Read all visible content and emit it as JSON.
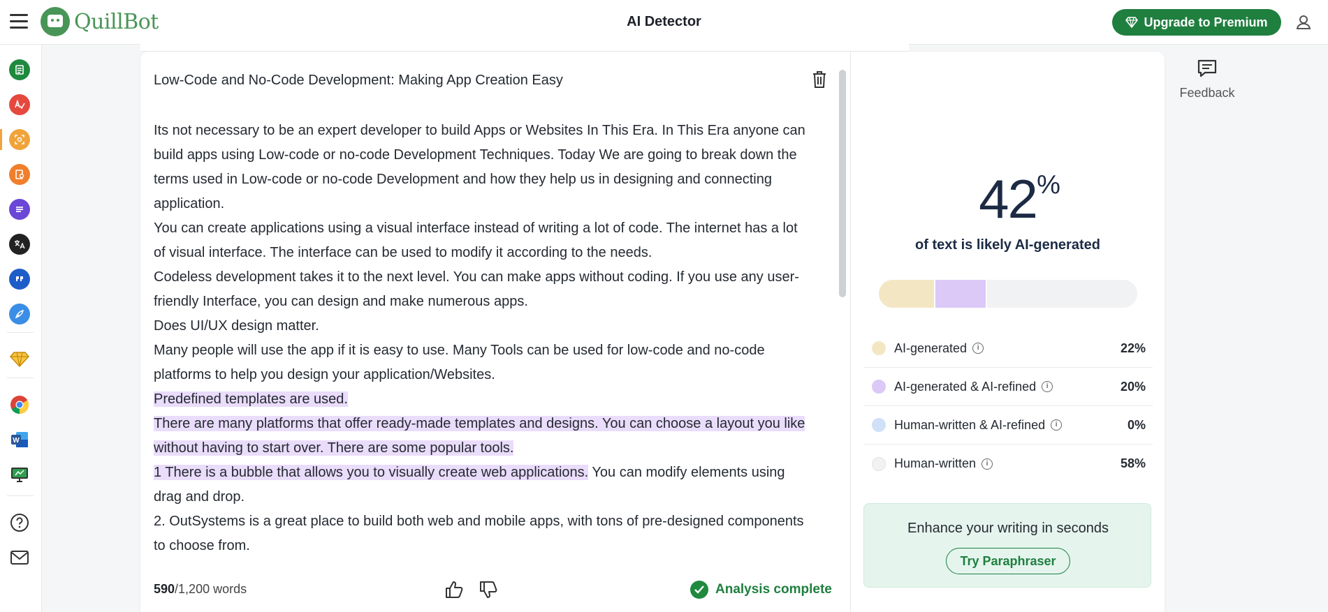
{
  "app": {
    "logo_text": "QuillBot",
    "page_title": "AI Detector",
    "upgrade_label": "Upgrade to Premium"
  },
  "sidebar": {
    "items": [
      {
        "name": "paraphraser",
        "color": "#1f8a3e"
      },
      {
        "name": "grammar-checker",
        "color": "#e5483d"
      },
      {
        "name": "ai-detector",
        "color": "#f1a33b",
        "active": true
      },
      {
        "name": "plagiarism-checker",
        "color": "#f07e2b"
      },
      {
        "name": "summarizer",
        "color": "#6a47d6"
      },
      {
        "name": "translator",
        "color": "#222222"
      },
      {
        "name": "citation-generator",
        "color": "#1e5cc8"
      },
      {
        "name": "ai-writer",
        "color": "#3b8ee6"
      },
      {
        "name": "premium",
        "color": "#e9a617"
      },
      {
        "name": "chrome-extension",
        "color": "#db4437"
      },
      {
        "name": "word-addin",
        "color": "#2b579a"
      },
      {
        "name": "desktop-app",
        "color": "#2e7d32"
      },
      {
        "name": "help",
        "color": "#333333"
      },
      {
        "name": "contact",
        "color": "#333333"
      }
    ]
  },
  "editor": {
    "title": "Low-Code and No-Code Development: Making App Creation Easy",
    "paragraphs": [
      {
        "segments": [
          {
            "text": "Its not necessary to be an expert developer to build Apps or Websites In This Era. In This Era anyone can build apps using Low-code or no-code Development Techniques. Today We are going to break down the terms used in Low-code or no-code Development  and how they help  us in designing and connecting application.",
            "highlight": false
          }
        ]
      },
      {
        "segments": [
          {
            "text": "You can create applications using a visual interface instead of writing a lot of code. The internet has a lot of visual interface. The interface can be used to modify it according to the needs.",
            "highlight": false
          }
        ]
      },
      {
        "segments": [
          {
            "text": "Codeless development takes it to the next level. You can make apps without coding. If you use any user-friendly Interface, you can design and make numerous apps.",
            "highlight": false
          }
        ]
      },
      {
        "segments": [
          {
            "text": "Does UI/UX design matter.",
            "highlight": false
          }
        ]
      },
      {
        "segments": [
          {
            "text": "Many people will use the app if it is easy to use. Many Tools can be used for low-code and no-code platforms to help you design your application/Websites.",
            "highlight": false
          }
        ]
      },
      {
        "segments": [
          {
            "text": "Predefined templates are used.",
            "highlight": true
          }
        ]
      },
      {
        "segments": [
          {
            "text": "There are many platforms that offer ready-made templates and designs. You can choose a layout you like without having to start over. There are some popular tools.",
            "highlight": true
          }
        ]
      },
      {
        "segments": [
          {
            "text": "1 There is a bubble that allows you to visually create web applications.",
            "highlight": true
          },
          {
            "text": " You can modify elements using drag and drop.",
            "highlight": false
          }
        ]
      },
      {
        "segments": [
          {
            "text": "2. OutSystems is a great place to build both web and mobile apps, with tons of pre-designed components to choose from.",
            "highlight": false
          }
        ]
      }
    ],
    "word_count": "590",
    "word_limit": "/1,200 words",
    "status": "Analysis complete"
  },
  "results": {
    "score": "42",
    "score_unit": "%",
    "caption": "of text is likely AI-generated",
    "bar": [
      {
        "fraction": 0.22,
        "color": "#f3e7c3"
      },
      {
        "fraction": 0.2,
        "color": "#dcc9f7"
      },
      {
        "fraction": 0.0,
        "color": "#cfe0f7"
      },
      {
        "fraction": 0.58,
        "color": "#f1f2f3"
      }
    ],
    "legend": [
      {
        "label": "AI-generated",
        "value": "22%",
        "color": "#f3e7c3"
      },
      {
        "label": "AI-generated & AI-refined",
        "value": "20%",
        "color": "#dcc9f7"
      },
      {
        "label": "Human-written & AI-refined",
        "value": "0%",
        "color": "#cfe0f7"
      },
      {
        "label": "Human-written",
        "value": "58%",
        "color": "#f1f2f3"
      }
    ],
    "promo_text": "Enhance your writing in seconds",
    "promo_button": "Try Paraphraser"
  },
  "feedback": {
    "label": "Feedback"
  }
}
